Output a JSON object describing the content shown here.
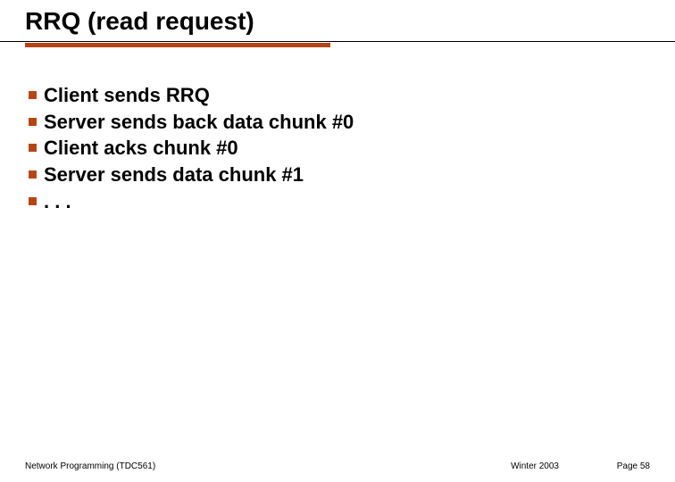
{
  "slide": {
    "title": "RRQ (read request)",
    "bullets": [
      "Client sends RRQ",
      "Server sends back data chunk #0",
      "Client acks chunk #0",
      "Server sends data chunk #1",
      ". . ."
    ],
    "footer": {
      "left": "Network Programming (TDC561)",
      "mid": "Winter 2003",
      "right": "Page 58"
    }
  }
}
